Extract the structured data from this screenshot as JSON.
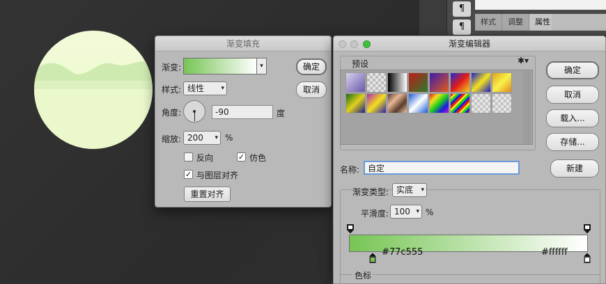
{
  "canvas": {
    "background": "#2f2f2f"
  },
  "artwork": {
    "circle_light": "#f3fbd9",
    "hill_color": "#cfeab0",
    "horizon_color": "#e2f4c6"
  },
  "ps_panel": {
    "tabs": [
      "样式",
      "调整",
      "属性"
    ],
    "active_tab": "属性"
  },
  "gradient_fill": {
    "title": "渐变填充",
    "gradient_label": "渐变:",
    "style_label": "样式:",
    "style_value": "线性",
    "angle_label": "角度:",
    "angle_value": "-90",
    "angle_unit": "度",
    "scale_label": "缩放:",
    "scale_value": "200",
    "scale_unit": "%",
    "reverse_label": "反向",
    "reverse_checked": false,
    "dither_label": "仿色",
    "dither_checked": true,
    "align_label": "与图层对齐",
    "align_checked": true,
    "reset_align_label": "重置对齐",
    "ok_label": "确定",
    "cancel_label": "取消",
    "gradient_from": "#77c555",
    "gradient_to": "#ffffff"
  },
  "gradient_editor": {
    "title": "渐变编辑器",
    "presets_label": "预设",
    "name_label": "名称:",
    "name_value": "自定",
    "ok_label": "确定",
    "cancel_label": "取消",
    "load_label": "载入...",
    "save_label": "存储...",
    "new_label": "新建",
    "gradient_type_label": "渐变类型:",
    "gradient_type_value": "实底",
    "smoothness_label": "平滑度:",
    "smoothness_value": "100",
    "smoothness_unit": "%",
    "color_stop_left": "#77c555",
    "color_stop_right": "#ffffff",
    "stops_section_label": "色标",
    "presets": [
      "linear-gradient(135deg,#d9d2ee,#6a58a8)",
      "repeating-conic-gradient(#e6e6e6 0 25%,#bdbdbd 0 50%) 0 0/8px 8px",
      "linear-gradient(90deg,#000,#fff)",
      "linear-gradient(135deg,#c01b1b,#2b7b2b)",
      "linear-gradient(135deg,#3b1bb0,#e25a1a)",
      "linear-gradient(135deg,#1b2bd8,#e01b1b,#f4d31b)",
      "linear-gradient(135deg,#1b1bd0,#f4e41b,#1b1bd0)",
      "linear-gradient(135deg,#e0a01b,#f8f24a,#e08a1b)",
      "linear-gradient(135deg,#1b6b1b,#e0d01b,#1b1b8b)",
      "linear-gradient(135deg,#b02bb0,#f4e01b,#2b1bb0)",
      "linear-gradient(135deg,#5a3a2a,#e8b898,#5a3a2a,#e8c8a8)",
      "linear-gradient(135deg,#1b5ad8,#ffffff,#1b5ad8)",
      "linear-gradient(135deg,#e01b1b,#f4e01b,#1bd01b,#1b1be0,#b01bd0)",
      "repeating-linear-gradient(135deg,#e01b1b 0 3px,#f4e01b 3px 6px,#1bd01b 6px 9px,#1b1be0 9px 12px)",
      "repeating-conic-gradient(#e6e6e6 0 25%,#c4c4c4 0 50%) 0 0/8px 8px",
      "repeating-conic-gradient(#e6e6e6 0 25%,#c4c4c4 0 50%) 0 0/8px 8px"
    ]
  }
}
